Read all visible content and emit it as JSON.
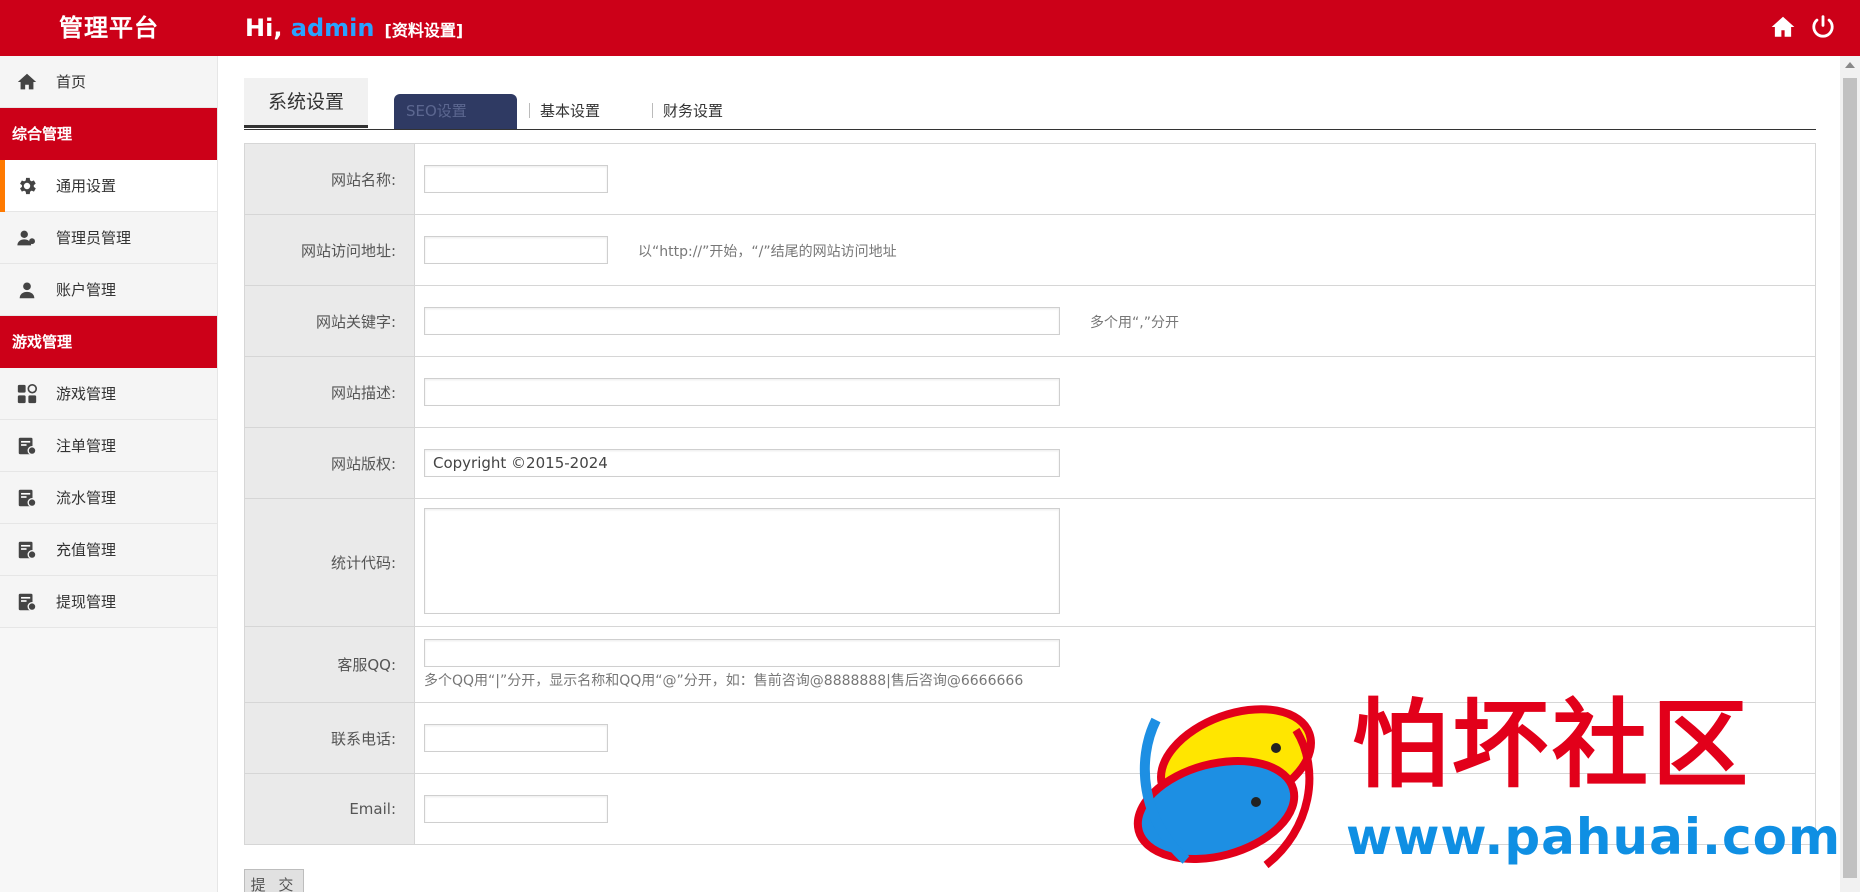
{
  "header": {
    "brand": "管理平台",
    "greeting_prefix": "Hi, ",
    "username": "admin",
    "profile_link": "[资料设置]",
    "icons": [
      "home-icon",
      "power-icon"
    ]
  },
  "sidebar": {
    "home": "首页",
    "group1": "综合管理",
    "general_settings": "通用设置",
    "admin_mgmt": "管理员管理",
    "account_mgmt": "账户管理",
    "group2": "游戏管理",
    "game_mgmt": "游戏管理",
    "bet_mgmt": "注单管理",
    "flow_mgmt": "流水管理",
    "recharge_mgmt": "充值管理",
    "withdraw_mgmt": "提现管理"
  },
  "tabs": {
    "title": "系统设置",
    "seo": "SEO设置",
    "basic": "基本设置",
    "finance": "财务设置"
  },
  "form": {
    "site_name_label": "网站名称:",
    "site_url_label": "网站访问地址:",
    "site_url_hint": "以“http://”开始，“/”结尾的网站访问地址",
    "keywords_label": "网站关键字:",
    "keywords_hint": "多个用“,”分开",
    "desc_label": "网站描述:",
    "copyright_label": "网站版权:",
    "copyright_value": "Copyright ©2015-2024",
    "stats_label": "统计代码:",
    "qq_label": "客服QQ:",
    "qq_hint": "多个QQ用“|”分开，显示名称和QQ用“@”分开，如：售前咨询@8888888|售后咨询@6666666",
    "phone_label": "联系电话:",
    "email_label": "Email:",
    "submit": "提 交"
  },
  "watermark": {
    "text": "怕坏社区",
    "url": "www.pahuai.com"
  },
  "colors": {
    "brand_red": "#cc0018",
    "accent_orange": "#ff7a00",
    "username_blue": "#2aa2ff",
    "seo_tab_bg": "#2f3a63"
  }
}
